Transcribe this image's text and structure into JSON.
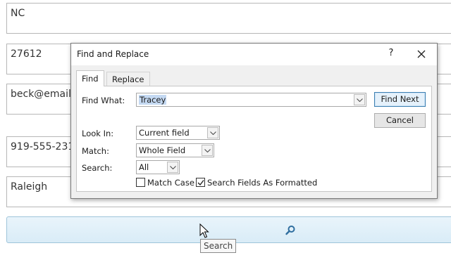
{
  "background": {
    "fields": [
      {
        "name": "state-field",
        "value": "NC"
      },
      {
        "name": "zip-field",
        "value": "27612"
      },
      {
        "name": "email-field",
        "value": "beck@email.co"
      },
      {
        "name": "phone-field",
        "value": "919-555-2314"
      },
      {
        "name": "city-field",
        "value": "Raleigh"
      }
    ],
    "search_button_icon": "search-icon",
    "tooltip": "Search"
  },
  "dialog": {
    "title": "Find and Replace",
    "help_label": "?",
    "close_icon": "close-icon",
    "tabs": [
      {
        "label": "Find",
        "active": true
      },
      {
        "label": "Replace",
        "active": false
      }
    ],
    "find_what": {
      "label": "Find What:",
      "value": "Tracey"
    },
    "look_in": {
      "label": "Look In:",
      "value": "Current field"
    },
    "match": {
      "label": "Match:",
      "value": "Whole Field"
    },
    "search": {
      "label": "Search:",
      "value": "All"
    },
    "match_case": {
      "label": "Match Case",
      "checked": false
    },
    "search_formatted": {
      "label": "Search Fields As Formatted",
      "checked": true
    },
    "buttons": {
      "find_next": "Find Next",
      "cancel": "Cancel"
    }
  },
  "colors": {
    "selection": "#c4d9f2",
    "primary_border": "#3c7fb1",
    "search_bar": "#d9ecf7"
  }
}
